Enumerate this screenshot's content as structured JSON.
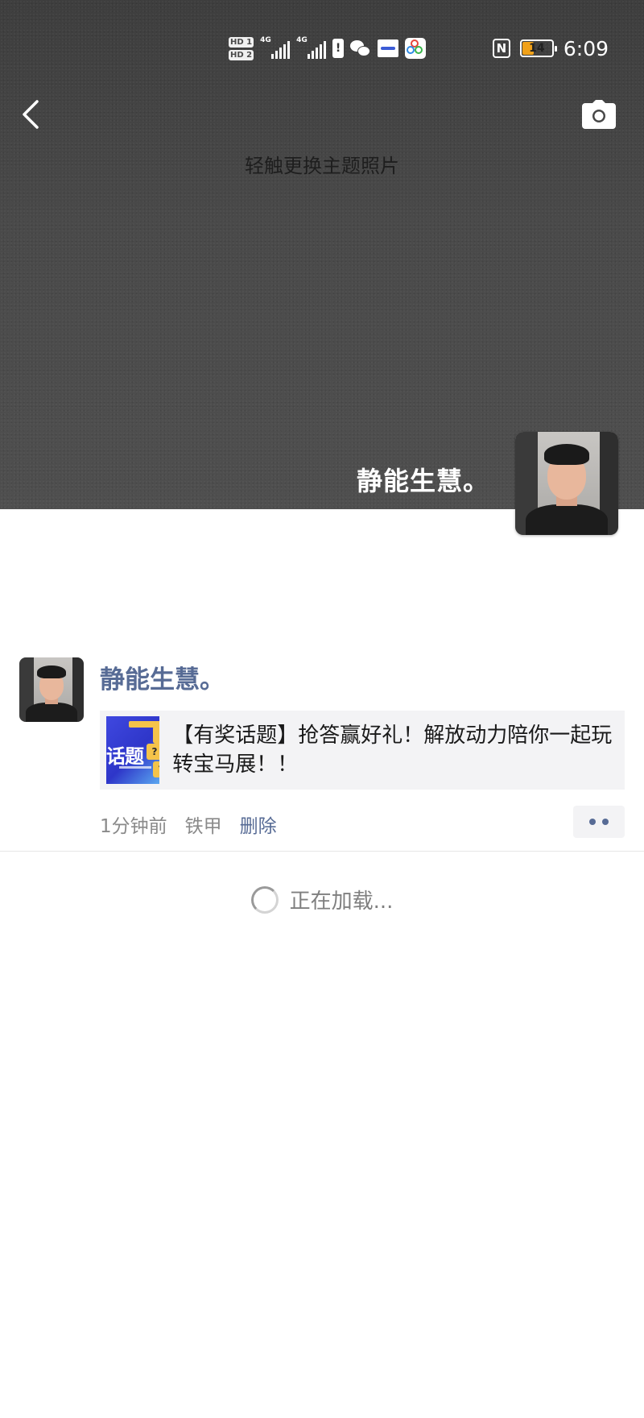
{
  "status_bar": {
    "hd1": "HD 1",
    "hd2": "HD 2",
    "network1": "4G",
    "network2": "4G",
    "battery_level": "14",
    "time": "6:09"
  },
  "cover": {
    "hint": "轻触更换主题照片",
    "owner_name": "静能生慧。"
  },
  "post": {
    "author": "静能生慧。",
    "link_title": "【有奖话题】抢答赢好礼！解放动力陪你一起玩转宝马展！！",
    "thumb_text": "话题",
    "time_ago": "1分钟前",
    "source": "铁甲",
    "delete_label": "删除"
  },
  "loading": {
    "text": "正在加载..."
  },
  "colors": {
    "link_blue": "#576b95",
    "cover_gray": "#484848",
    "battery_fill": "#f0a11a"
  }
}
